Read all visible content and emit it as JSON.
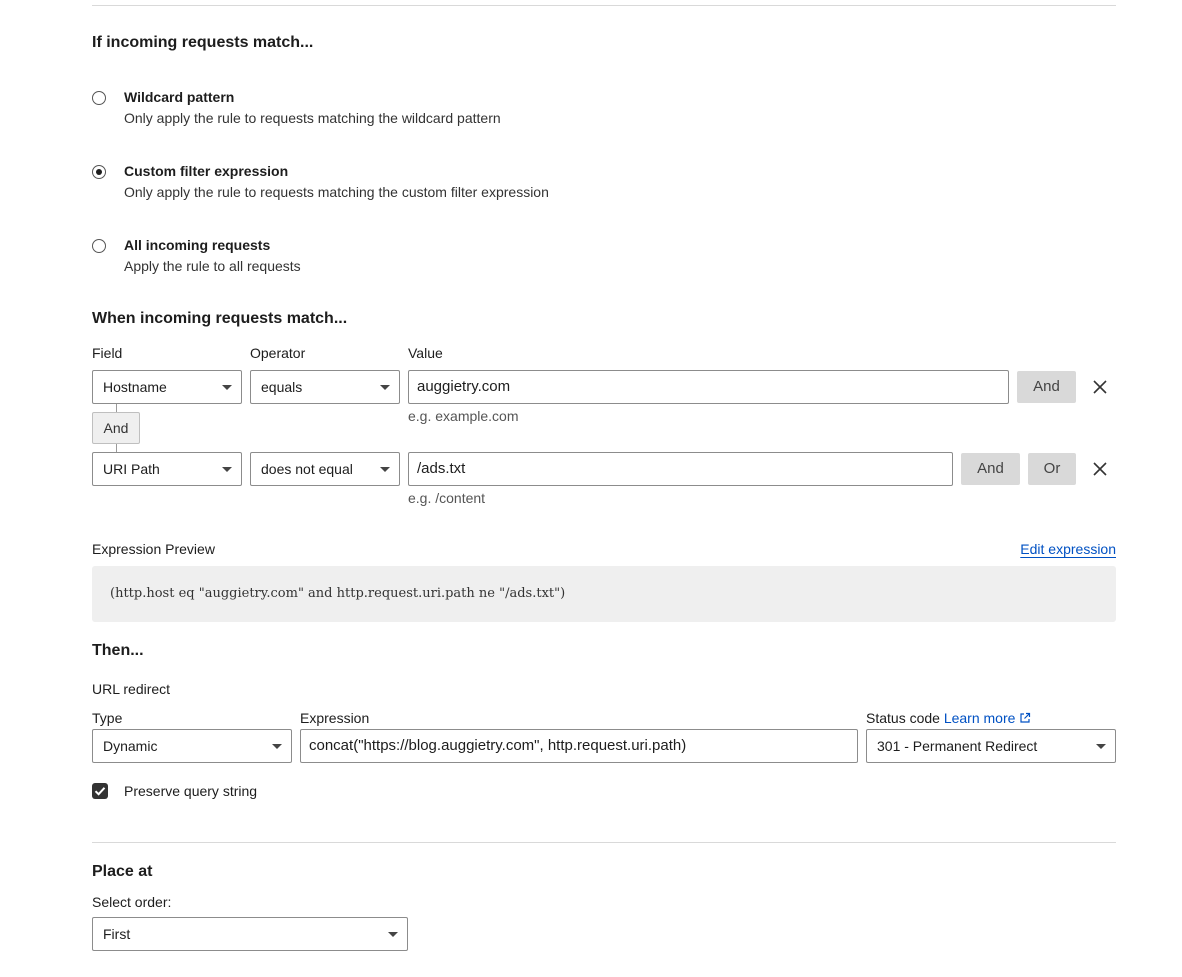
{
  "match_section": {
    "heading": "If incoming requests match...",
    "options": [
      {
        "title": "Wildcard pattern",
        "description": "Only apply the rule to requests matching the wildcard pattern",
        "checked": false
      },
      {
        "title": "Custom filter expression",
        "description": "Only apply the rule to requests matching the custom filter expression",
        "checked": true
      },
      {
        "title": "All incoming requests",
        "description": "Apply the rule to all requests",
        "checked": false
      }
    ]
  },
  "filter_section": {
    "heading": "When incoming requests match...",
    "columns": {
      "field": "Field",
      "operator": "Operator",
      "value": "Value"
    },
    "rows": [
      {
        "field": "Hostname",
        "operator": "equals",
        "value": "auggietry.com",
        "hint": "e.g. example.com",
        "buttons": [
          "And"
        ]
      },
      {
        "field": "URI Path",
        "operator": "does not equal",
        "value": "/ads.txt",
        "hint": "e.g. /content",
        "buttons": [
          "And",
          "Or"
        ]
      }
    ],
    "connector_label": "And"
  },
  "preview": {
    "label": "Expression Preview",
    "edit_link": "Edit expression",
    "expression": "(http.host eq \"auggietry.com\" and http.request.uri.path ne \"/ads.txt\")"
  },
  "then_section": {
    "heading": "Then...",
    "action": "URL redirect",
    "type_label": "Type",
    "type_value": "Dynamic",
    "expression_label": "Expression",
    "expression_value": "concat(\"https://blog.auggietry.com\", http.request.uri.path)",
    "status_label": "Status code",
    "learn_more": "Learn more",
    "status_value": "301 - Permanent Redirect",
    "preserve_query": "Preserve query string",
    "preserve_checked": true
  },
  "place_section": {
    "heading": "Place at",
    "order_label": "Select order:",
    "order_value": "First"
  }
}
